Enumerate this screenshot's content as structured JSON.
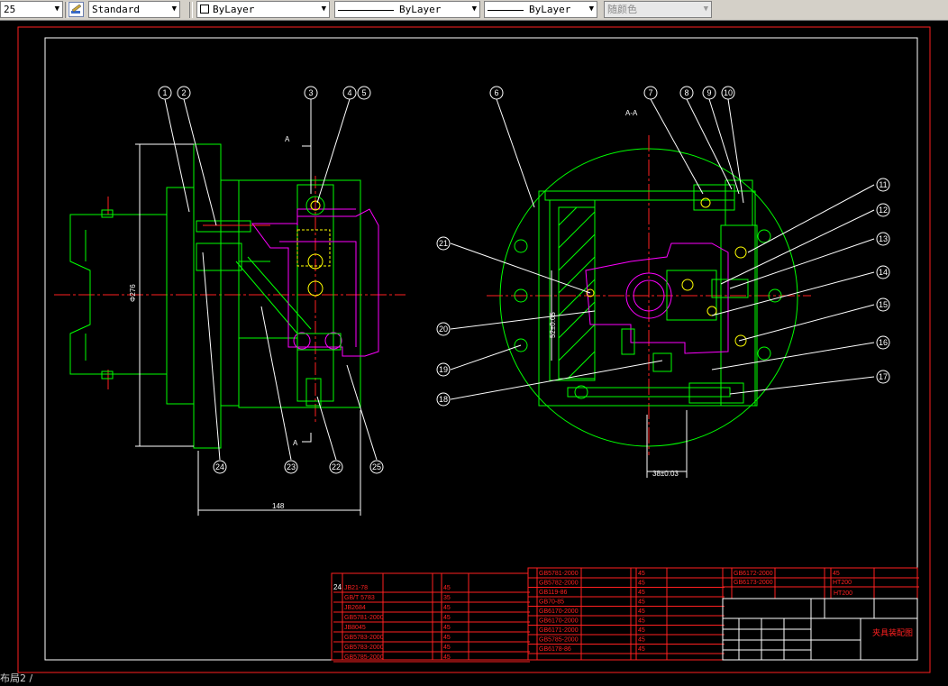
{
  "toolbar": {
    "scale_value": "25",
    "text_style": "Standard",
    "layer": "ByLayer",
    "linetype": "ByLayer",
    "lineweight": "ByLayer",
    "plot_color": "随颜色"
  },
  "drawing": {
    "section_label": "A-A",
    "view_marker_top": "A",
    "view_marker_bottom": "A",
    "dim_diameter": "Φ276",
    "dim_width": "148",
    "dim_center": "52±0.05",
    "dim_offset": "38±0.03",
    "part_numbers": [
      "1",
      "2",
      "3",
      "4",
      "5",
      "6",
      "7",
      "8",
      "9",
      "10",
      "11",
      "12",
      "13",
      "14",
      "15",
      "16",
      "17",
      "18",
      "19",
      "20",
      "21",
      "22",
      "23",
      "24",
      "25"
    ]
  },
  "title_block": {
    "drawing_name": "夹具装配图",
    "material": "HT200",
    "sheet_number": "24"
  },
  "bom": {
    "col1_rows": [
      "JB21-78",
      "GB/T 5783",
      "JB2684",
      "GB5781-2000",
      "JB8045",
      "GB5783-2000",
      "GB5783-2000",
      "GB5785-2000"
    ],
    "col1_materials": [
      "45",
      "35",
      "45",
      "45",
      "45",
      "45",
      "45",
      "45"
    ],
    "col2_rows": [
      "GB5781-2000",
      "GB5782-2000",
      "GB119-86",
      "GB70-85",
      "GB6170-2000",
      "GB6170-2000",
      "GB6171-2000",
      "GB5785-2000",
      "GB6178-86"
    ],
    "col2_materials": [
      "45",
      "45",
      "45",
      "45",
      "45",
      "45",
      "45",
      "45",
      "45"
    ],
    "col3_rows": [
      "GB6172-2000",
      "GB6173-2000"
    ],
    "col3_materials": [
      "45",
      "HT200"
    ]
  },
  "command_line": "布局2 /"
}
